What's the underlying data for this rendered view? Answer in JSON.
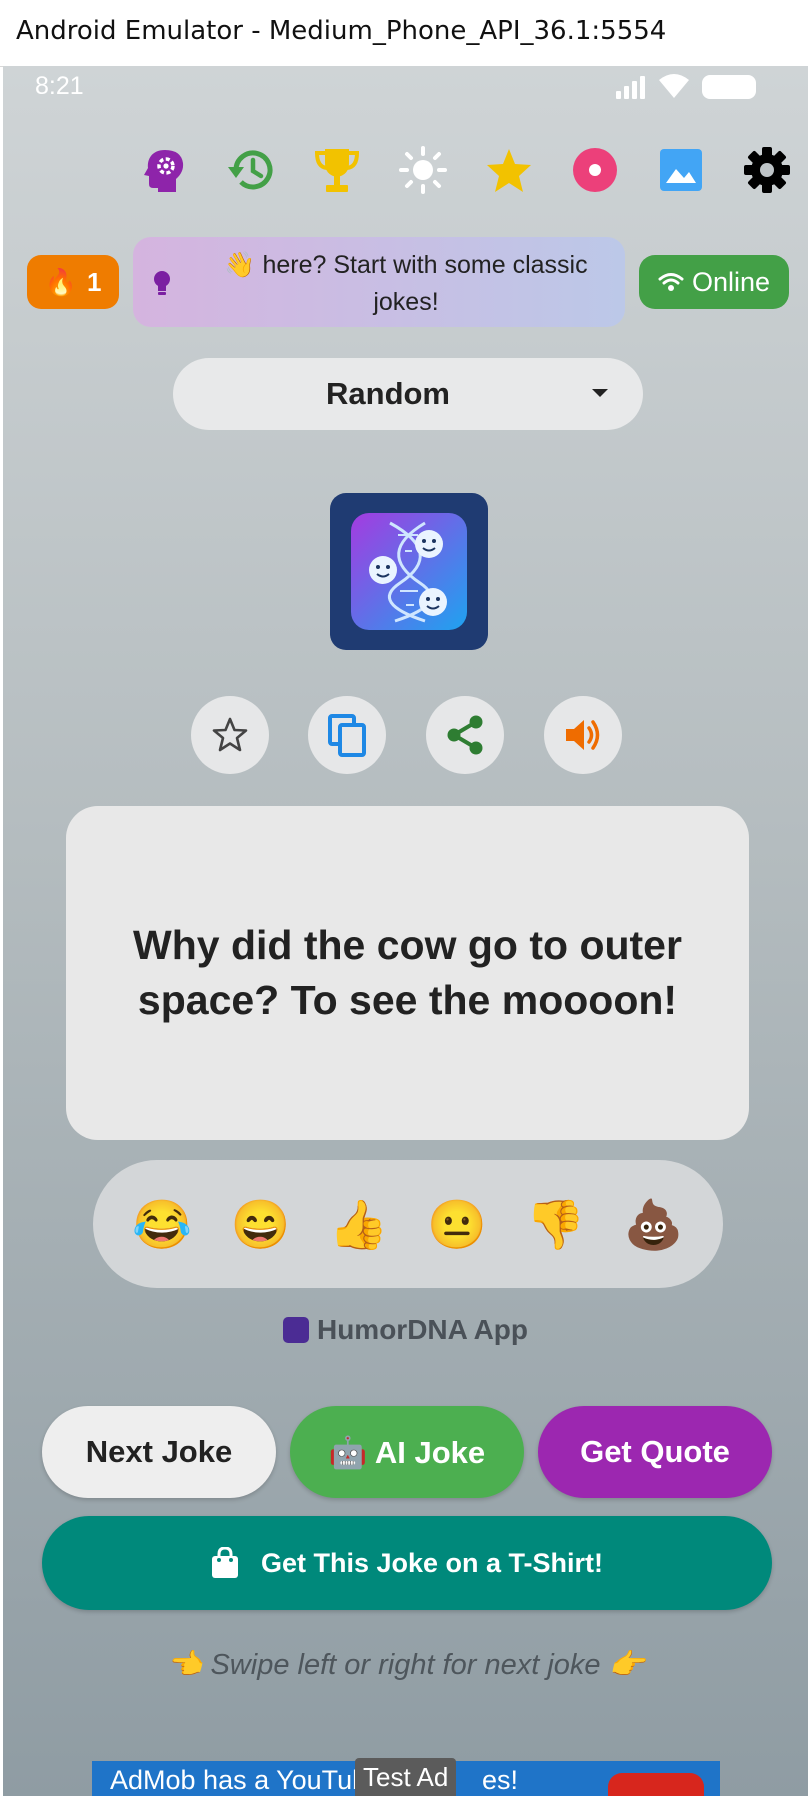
{
  "window": {
    "title": "Android Emulator - Medium_Phone_API_36.1:5554"
  },
  "status_bar": {
    "time": "8:21",
    "icons": [
      "signal-icon",
      "wifi-icon",
      "battery-icon"
    ]
  },
  "toolbar": {
    "icons": [
      {
        "name": "brain-settings-icon",
        "color": "#8e24aa"
      },
      {
        "name": "history-icon",
        "color": "#43a047"
      },
      {
        "name": "trophy-icon",
        "color": "#f2c200"
      },
      {
        "name": "brightness-icon",
        "color": "#ffffff"
      },
      {
        "name": "star-icon",
        "color": "#f2c200"
      },
      {
        "name": "disc-icon",
        "color": "#ec407a"
      },
      {
        "name": "image-icon",
        "color": "#42a5f5"
      },
      {
        "name": "settings-icon",
        "color": "#000000"
      }
    ]
  },
  "streak": {
    "icon": "🔥",
    "count": "1"
  },
  "hint": {
    "text": "👋 here? Start with some classic jokes!"
  },
  "connection": {
    "label": "Online",
    "color": "#43a047"
  },
  "category": {
    "selected": "Random"
  },
  "actions": [
    "favorite-star-icon",
    "copy-icon",
    "share-icon",
    "speaker-icon"
  ],
  "joke": {
    "text": "Why did the cow go to outer space? To see the moooon!"
  },
  "reactions": [
    {
      "name": "reaction-laughing-tears",
      "emoji": "😂"
    },
    {
      "name": "reaction-grinning",
      "emoji": "😄"
    },
    {
      "name": "reaction-thumbs-up",
      "emoji": "👍"
    },
    {
      "name": "reaction-neutral",
      "emoji": "😐"
    },
    {
      "name": "reaction-thumbs-down",
      "emoji": "👎"
    },
    {
      "name": "reaction-poop",
      "emoji": "💩"
    }
  ],
  "brand": {
    "label": "HumorDNA App"
  },
  "buttons": {
    "next": "Next Joke",
    "ai": "🤖 AI Joke",
    "quote": "Get Quote",
    "shirt": "Get This Joke on a T-Shirt!"
  },
  "colors": {
    "ai_button": "#43a047",
    "quote_button": "#9c27b0",
    "shirt_button": "#00897b",
    "streak": "#ef7c00"
  },
  "swipe_hint": "👈 Swipe left or right for next joke 👉",
  "ad": {
    "text": "AdMob has a YouTube",
    "tail": "es!",
    "tag": "Test Ad"
  }
}
